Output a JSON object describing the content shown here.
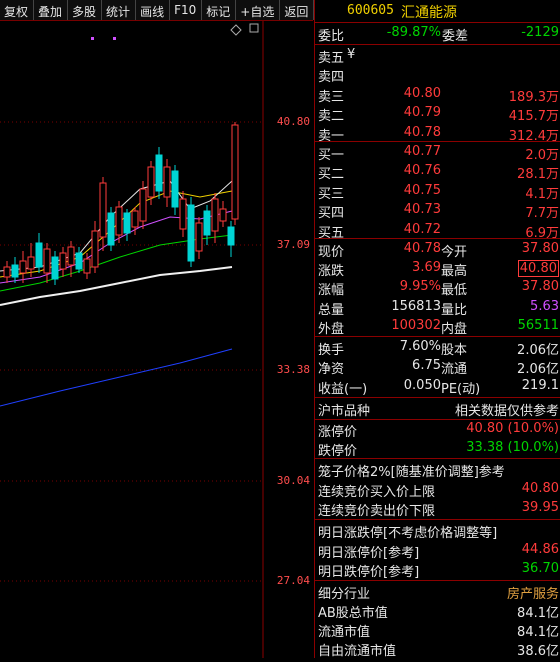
{
  "toolbar": [
    "复权",
    "叠加",
    "多股",
    "统计",
    "画线",
    "F10",
    "标记",
    "+自选",
    "返回"
  ],
  "axis": [
    "40.80",
    "37.09",
    "33.38",
    "30.04",
    "27.04"
  ],
  "stock": {
    "code": "600605",
    "name": "汇通能源"
  },
  "ratio": {
    "l1": "委比",
    "v1": "-89.87%",
    "l2": "委差",
    "v2": "-2129"
  },
  "sell": [
    {
      "label": "卖五",
      "price": "",
      "vol": ""
    },
    {
      "label": "卖四",
      "price": "",
      "vol": ""
    },
    {
      "label": "卖三",
      "price": "40.80",
      "vol": "189.3万"
    },
    {
      "label": "卖二",
      "price": "40.79",
      "vol": "415.7万"
    },
    {
      "label": "卖一",
      "price": "40.78",
      "vol": "312.4万"
    }
  ],
  "yen": "¥",
  "buy": [
    {
      "label": "买一",
      "price": "40.77",
      "vol": "2.0万"
    },
    {
      "label": "买二",
      "price": "40.76",
      "vol": "28.1万"
    },
    {
      "label": "买三",
      "price": "40.75",
      "vol": "4.1万"
    },
    {
      "label": "买四",
      "price": "40.73",
      "vol": "7.7万"
    },
    {
      "label": "买五",
      "price": "40.72",
      "vol": "6.9万"
    }
  ],
  "quote": [
    {
      "l1": "现价",
      "v1": "40.78",
      "l2": "今开",
      "v2": "37.80"
    },
    {
      "l1": "涨跌",
      "v1": "3.69",
      "l2": "最高",
      "v2": "40.80"
    },
    {
      "l1": "涨幅",
      "v1": "9.95%",
      "l2": "最低",
      "v2": "37.80"
    },
    {
      "l1": "总量",
      "v1": "156813",
      "l2": "量比",
      "v2": "5.63"
    },
    {
      "l1": "外盘",
      "v1": "100302",
      "l2": "内盘",
      "v2": "56511"
    }
  ],
  "stats": [
    {
      "l1": "换手",
      "v1": "7.60%",
      "l2": "股本",
      "v2": "2.06亿"
    },
    {
      "l1": "净资",
      "v1": "6.75",
      "l2": "流通",
      "v2": "2.06亿"
    },
    {
      "l1": "收益(一)",
      "v1": "0.050",
      "l2": "PE(动)",
      "v2": "219.1"
    }
  ],
  "market": {
    "left": "沪市品种",
    "right": "相关数据仅供参考"
  },
  "limit": [
    {
      "label": "涨停价",
      "value": "40.80 (10.0%)"
    },
    {
      "label": "跌停价",
      "value": "33.38 (10.0%)"
    }
  ],
  "cage": {
    "title": "笼子价格2%[随基准价调整]参考",
    "rows": [
      {
        "label": "连续竞价买入价上限",
        "value": "40.80"
      },
      {
        "label": "连续竞价卖出价下限",
        "value": "39.95"
      }
    ]
  },
  "tomorrow": {
    "title": "明日涨跌停[不考虑价格调整等]",
    "rows": [
      {
        "label": "明日涨停价[参考]",
        "value": "44.86"
      },
      {
        "label": "明日跌停价[参考]",
        "value": "36.70"
      }
    ]
  },
  "industry": {
    "title": "细分行业",
    "title_value": "房产服务",
    "rows": [
      {
        "label": "AB股总市值",
        "value": "84.1亿"
      },
      {
        "label": "流通市值",
        "value": "84.1亿"
      },
      {
        "label": "自由流通市值",
        "value": "38.6亿"
      }
    ]
  },
  "colors": {
    "up": "#ff3b3b",
    "down": "#00d4d4",
    "ma5": "#e6e6e6",
    "ma10": "#f0d000",
    "ma20": "#d050ff",
    "ma30": "#00d400",
    "ma60": "#f0f0f0",
    "ma250": "#2040ff"
  }
}
